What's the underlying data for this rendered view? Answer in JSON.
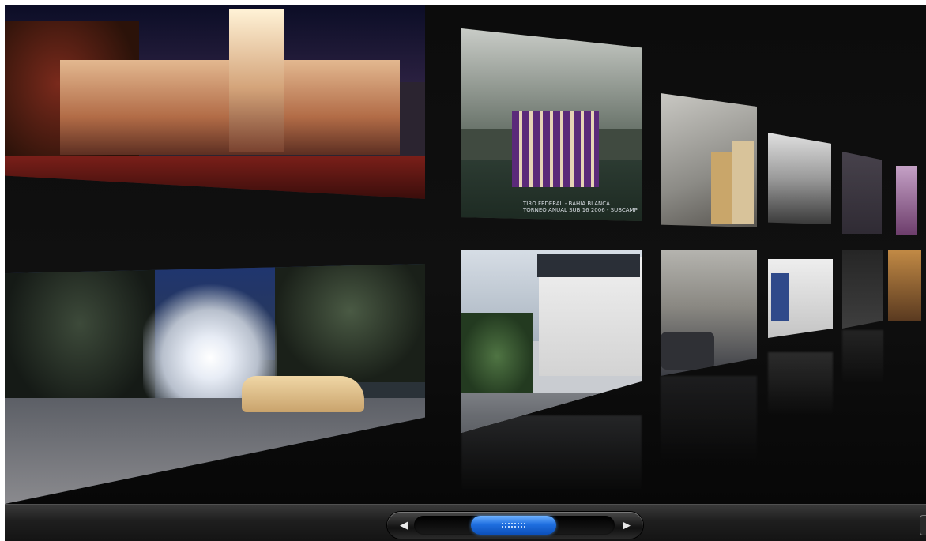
{
  "gallery": {
    "tiles": [
      {
        "subject": "Night view of illuminated palace"
      },
      {
        "subject": "Volleyball team photo",
        "caption_lines": [
          "TIRO FEDERAL - BAHIA BLANCA",
          "TORNEO ANUAL SUB 16 2006 - SUBCAMP"
        ]
      },
      {
        "subject": "Two men inspecting construction site"
      },
      {
        "subject": "Black and white harbor photo"
      },
      {
        "subject": "Entrance gate at night with taxi"
      },
      {
        "subject": "White house on street corner"
      },
      {
        "subject": "Street with parked cars"
      },
      {
        "subject": "Newspaper page"
      }
    ]
  },
  "scrollbar": {
    "left_icon": "◀",
    "right_icon": "▶",
    "position": 0.35
  },
  "colors": {
    "background": "#101010",
    "thumb": "#1f6fe0"
  }
}
